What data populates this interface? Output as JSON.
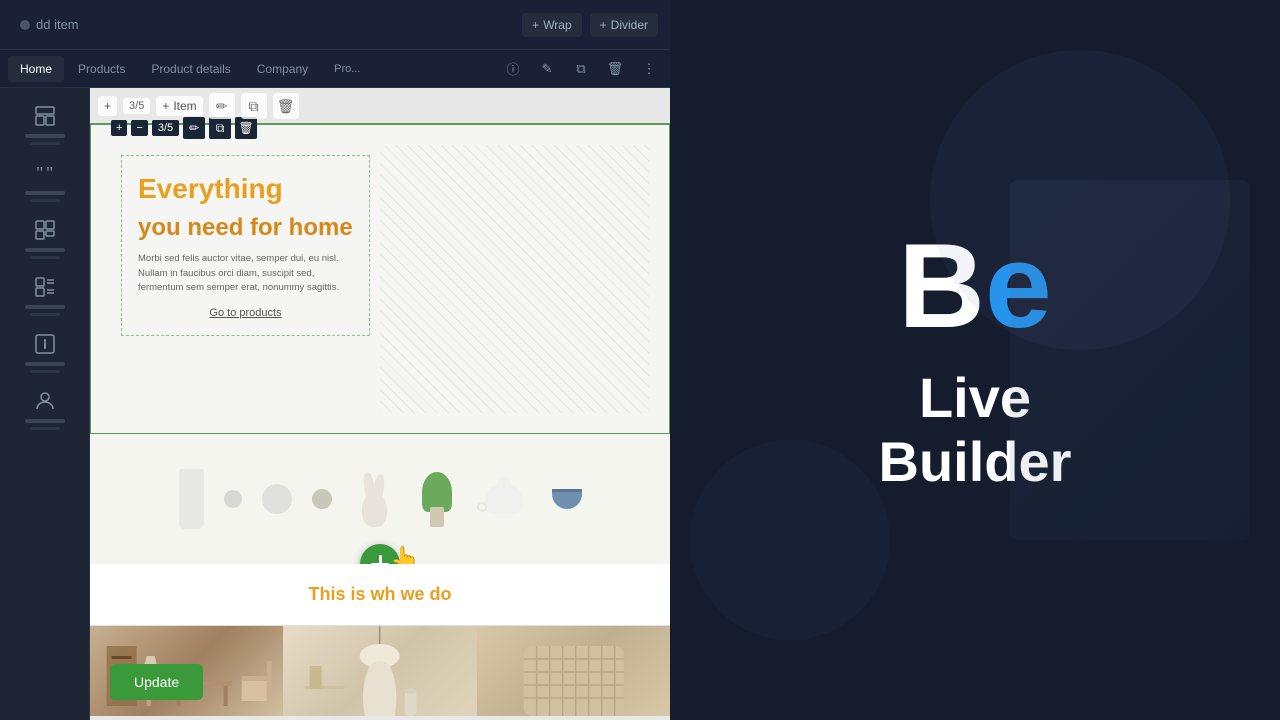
{
  "builder": {
    "title": "Live Builder",
    "logo": {
      "b": "B",
      "e": "e"
    },
    "toolbar": {
      "add_item_label": "dd item",
      "wrap_label": "Wrap",
      "divider_label": "Divider",
      "plus_symbol": "+",
      "minus_symbol": "−",
      "update_label": "Update"
    },
    "nav": {
      "tabs": [
        "Home",
        "Products",
        "Product details",
        "Company",
        "Pro..."
      ],
      "active_tab": "Home"
    },
    "item_toolbar": {
      "counter": "3/5",
      "item_label": "Item"
    },
    "inner_toolbar": {
      "counter": "3/5"
    },
    "icons": {
      "info": "ⓘ",
      "pen": "✎",
      "copy": "⧉",
      "trash": "🗑",
      "more": "⋮",
      "pencil": "✏",
      "link": "🔗"
    },
    "website": {
      "hero": {
        "title_line1": "Everything",
        "title_line2": "you need for home",
        "body": "Morbi sed felis auctor vitae, semper dui, eu nisl. Nullam in faucibus orci diam, suscipit sed, fermentum sem semper erat, nonummy sagittis.",
        "cta": "Go to products"
      },
      "section2_title": "This is wh    we do",
      "gallery_images": [
        {
          "label": "furniture-room"
        },
        {
          "label": "lamp-vase"
        },
        {
          "label": "basket-weave"
        }
      ]
    },
    "sidebar_items": [
      {
        "icon": "layout-rows",
        "label": ""
      },
      {
        "icon": "quote",
        "label": ""
      },
      {
        "icon": "grid-2x2",
        "label": ""
      },
      {
        "icon": "list-text",
        "label": ""
      },
      {
        "icon": "info-box",
        "label": ""
      },
      {
        "icon": "user",
        "label": ""
      }
    ],
    "colors": {
      "accent_green": "#3a9a3a",
      "logo_blue": "#2196F3",
      "hero_text": "#e8a020",
      "dark_bg": "#141c2e",
      "panel_bg": "#1e2535"
    }
  }
}
